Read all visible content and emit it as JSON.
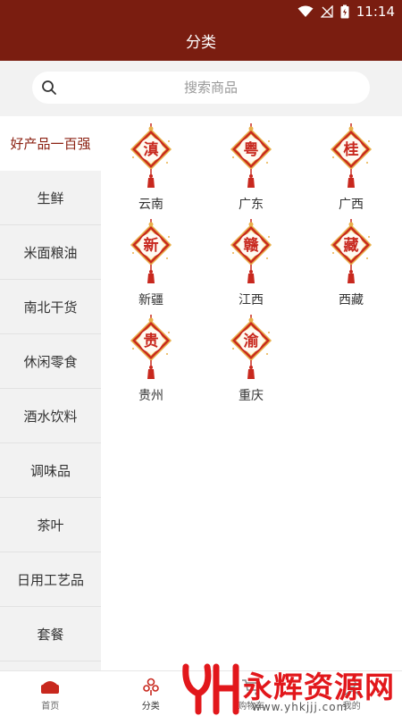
{
  "status_bar": {
    "time": "11:14"
  },
  "header": {
    "title": "分类"
  },
  "search": {
    "placeholder": "搜索商品"
  },
  "sidebar": {
    "items": [
      {
        "label": "好产品一百强",
        "active": true
      },
      {
        "label": "生鲜"
      },
      {
        "label": "米面粮油"
      },
      {
        "label": "南北干货"
      },
      {
        "label": "休闲零食"
      },
      {
        "label": "酒水饮料"
      },
      {
        "label": "调味品"
      },
      {
        "label": "茶叶"
      },
      {
        "label": "日用工艺品"
      },
      {
        "label": "套餐"
      }
    ]
  },
  "regions": [
    {
      "glyph": "滇",
      "name": "云南"
    },
    {
      "glyph": "粤",
      "name": "广东"
    },
    {
      "glyph": "桂",
      "name": "广西"
    },
    {
      "glyph": "新",
      "name": "新疆"
    },
    {
      "glyph": "赣",
      "name": "江西"
    },
    {
      "glyph": "藏",
      "name": "西藏"
    },
    {
      "glyph": "贵",
      "name": "贵州"
    },
    {
      "glyph": "渝",
      "name": "重庆"
    }
  ],
  "bottom_nav": {
    "items": [
      {
        "label": "首页",
        "icon": "home-icon"
      },
      {
        "label": "分类",
        "icon": "category-icon",
        "active": true
      },
      {
        "label": "购物车",
        "icon": "cart-icon"
      },
      {
        "label": "我的",
        "icon": "profile-icon"
      }
    ]
  },
  "watermark": {
    "text": "永辉资源网",
    "url": "www.yhkjjj.com"
  },
  "colors": {
    "brand": "#7a1d10",
    "active_text": "#8b2011",
    "lantern": "#c8281e",
    "watermark": "#e2171b"
  }
}
